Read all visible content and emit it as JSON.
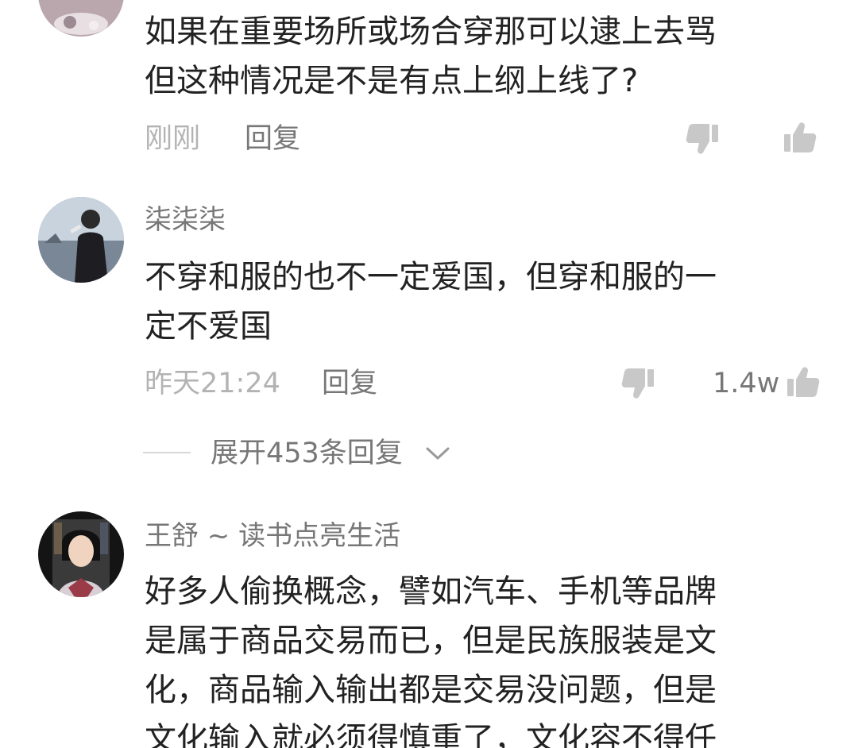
{
  "comments": [
    {
      "username": "",
      "lines": [
        "如果在重要场所或场合穿那可以逮上去骂",
        "但这种情况是不是有点上纲上线了?"
      ],
      "time": "刚刚",
      "reply_label": "回复",
      "like_count": ""
    },
    {
      "username": "柒柒柒",
      "lines": [
        "不穿和服的也不一定爱国，但穿和服的一",
        "定不爱国"
      ],
      "time": "昨天21:24",
      "reply_label": "回复",
      "like_count": "1.4w",
      "expand_replies": "展开453条回复"
    },
    {
      "username": "王舒 ~ 读书点亮生活",
      "lines": [
        "好多人偷换概念，譬如汽车、手机等品牌",
        "是属于商品交易而已，但是民族服装是文",
        "化，商品输入输出都是交易没问题，但是",
        "文化输入就必须得慎重了，文化容不得任"
      ]
    }
  ],
  "icons": {
    "dislike": "thumbs-down-icon",
    "like": "thumbs-up-icon",
    "expand": "chevron-down-icon"
  },
  "colors": {
    "text": "#222222",
    "muted": "#777777",
    "faint": "#b3b3b3",
    "icon": "#c8c8c8"
  }
}
